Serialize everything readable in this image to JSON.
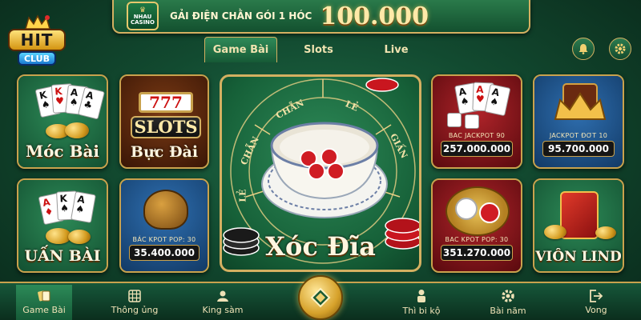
{
  "banner": {
    "badge_top": "NHAU",
    "badge_bottom": "CASINO",
    "text": "GẢI ĐIỆN CHẰN GÓI 1 HÓC",
    "amount": "100.000"
  },
  "logo": {
    "top": "HIT",
    "bottom": "CLUB"
  },
  "tabs": [
    {
      "label": "Game Bài",
      "active": true
    },
    {
      "label": "Slots",
      "active": false
    },
    {
      "label": "Live",
      "active": false
    }
  ],
  "header_icons": {
    "bell": "bell-icon",
    "settings": "gear-icon"
  },
  "tiles": {
    "moc_bai": {
      "title": "Móc Bài"
    },
    "buc_dai": {
      "title": "Bực Đài",
      "sign": "SLOTS",
      "reels": "777"
    },
    "uan_bai": {
      "title": "UẤN BÀI"
    },
    "slot_jp": {
      "jp_label": "BÁC KPOT POP: 30",
      "jp_value": "35.400.000"
    },
    "bac_jp": {
      "jp_label": "BAC JACKPOT 90",
      "jp_value": "257.000.000"
    },
    "crown_jp": {
      "jp_label": "JACKPOT ĐƠT 10",
      "jp_value": "95.700.000"
    },
    "xoc_jp": {
      "jp_label": "BAC KPOT POP: 30",
      "jp_value": "351.270.000"
    },
    "vion_lind": {
      "title": "VIÔN LIND"
    }
  },
  "center": {
    "title": "Xóc Đĩa",
    "ring": [
      "CHẴN",
      "LẺ",
      "CHẴN",
      "LẺ",
      "GIẤN"
    ]
  },
  "nav": [
    {
      "label": "Game Bài",
      "icon": "cards-icon",
      "active": true
    },
    {
      "label": "Thông ủng",
      "icon": "grid-icon",
      "active": false
    },
    {
      "label": "King sàm",
      "icon": "user-icon",
      "active": false
    },
    {
      "label": "Thì bi kộ",
      "icon": "person-icon",
      "active": false
    },
    {
      "label": "Bài năm",
      "icon": "settings-icon",
      "active": false
    },
    {
      "label": "Vong",
      "icon": "exit-icon",
      "active": false
    }
  ],
  "colors": {
    "gold": "#d4b061",
    "felt": "#166038",
    "accent": "#ffe9a8"
  }
}
